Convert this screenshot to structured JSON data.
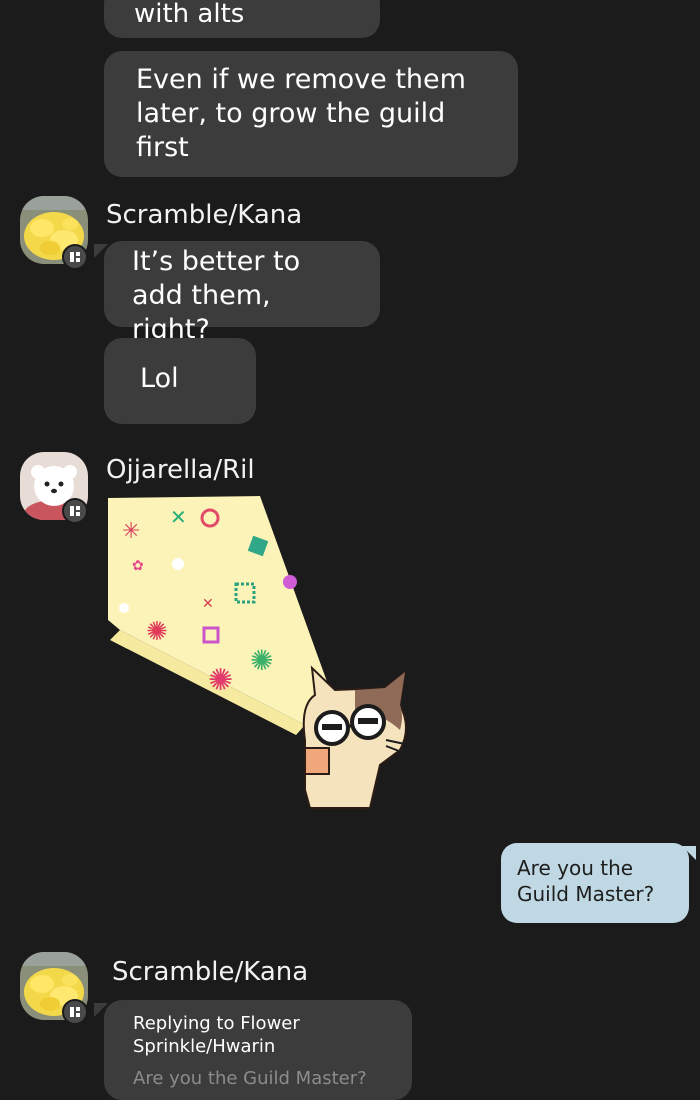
{
  "messages": {
    "m1": {
      "text": "with alts"
    },
    "m2": {
      "text": "Even if we remove them\nlater, to grow the guild\nfirst"
    },
    "m3": {
      "text": "It’s better to\nadd them, right?"
    },
    "m4": {
      "text": "Lol"
    },
    "m5": {
      "text": "Are you the\nGuild Master?"
    },
    "m6": {
      "reply_line": "Replying to Flower\nSprinkle/Hwarin",
      "quoted": "Are you the Guild Master?"
    }
  },
  "senders": {
    "scramble_kana": {
      "name": "Scramble/Kana",
      "avatar_icon": "scrambled-eggs-avatar"
    },
    "ojjarella_ril": {
      "name": "Ojjarella/Ril",
      "avatar_icon": "white-dog-avatar"
    }
  },
  "sticker": {
    "icon": "cat-party-popper-sticker"
  },
  "colors": {
    "background": "#1b1b1b",
    "incoming_bubble": "#3c3c3c",
    "outgoing_bubble": "#bfd8e3"
  }
}
